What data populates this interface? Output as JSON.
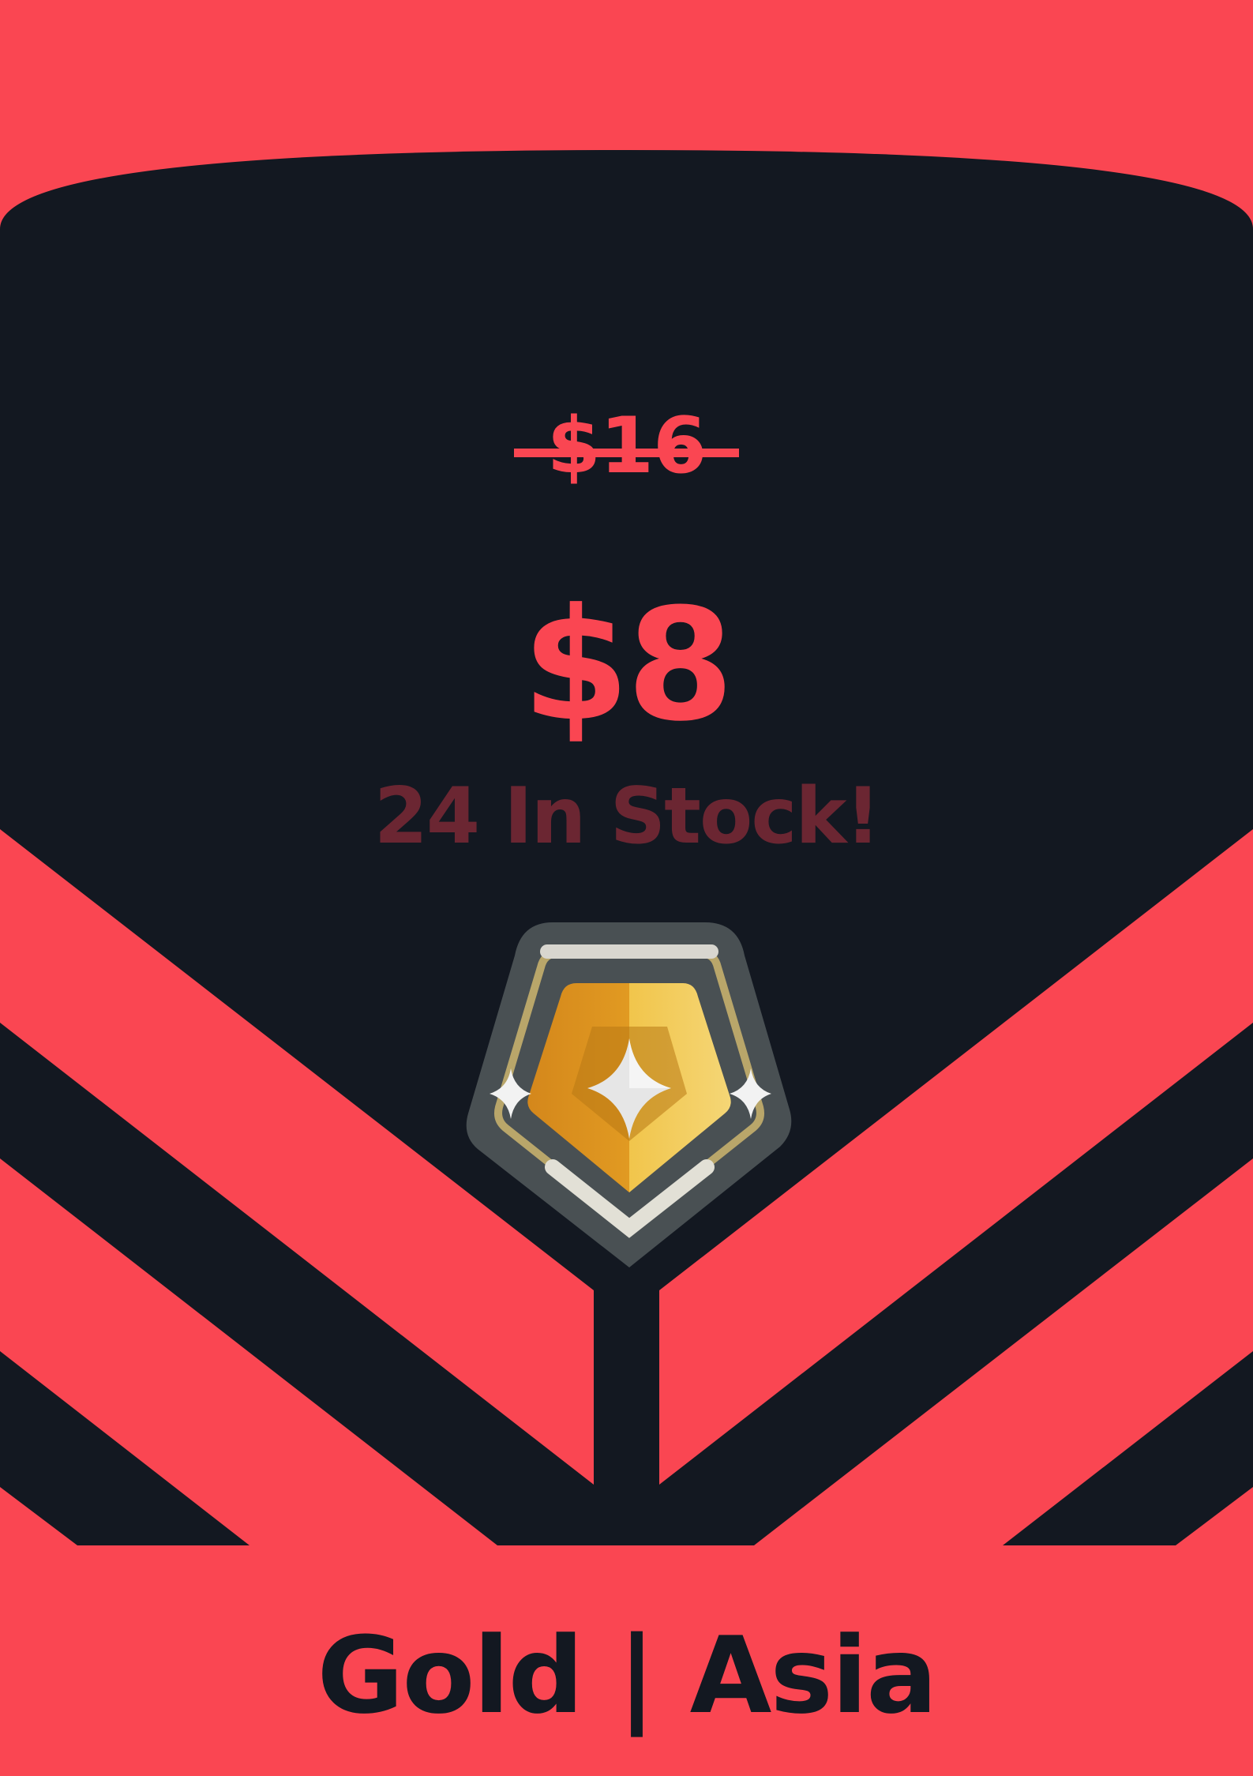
{
  "product": {
    "original_price": "$16",
    "sale_price": "$8",
    "stock": "24 In Stock!",
    "title": "Gold | Asia",
    "badge_icon": "gold-rank-badge-icon"
  },
  "colors": {
    "accent": "#FA4652",
    "dark": "#131821",
    "stock_text": "#6B2632",
    "badge_gold": "#E6A323",
    "badge_silver": "#C9C9C4"
  }
}
